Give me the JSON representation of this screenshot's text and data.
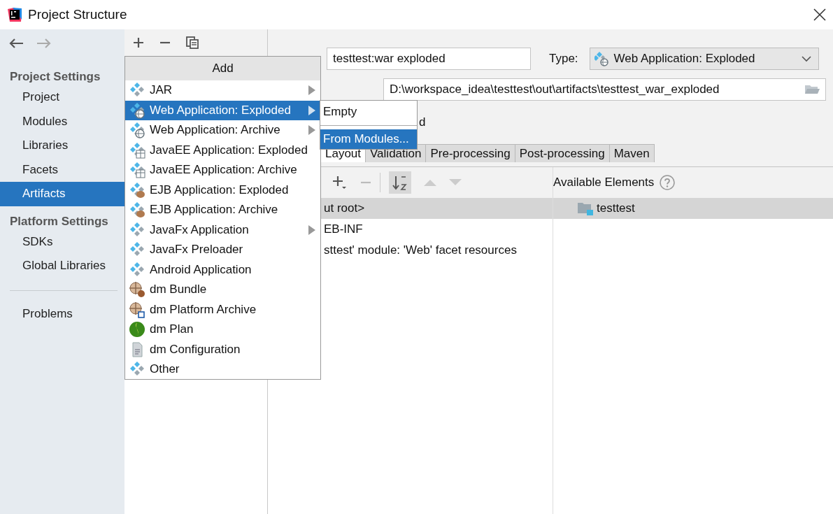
{
  "window": {
    "title": "Project Structure"
  },
  "sidebar": {
    "sections": [
      {
        "title": "Project Settings",
        "items": [
          {
            "label": "Project",
            "selected": false
          },
          {
            "label": "Modules",
            "selected": false
          },
          {
            "label": "Libraries",
            "selected": false
          },
          {
            "label": "Facets",
            "selected": false
          },
          {
            "label": "Artifacts",
            "selected": true
          }
        ]
      },
      {
        "title": "Platform Settings",
        "items": [
          {
            "label": "SDKs",
            "selected": false
          },
          {
            "label": "Global Libraries",
            "selected": false
          }
        ]
      }
    ],
    "extra_items": [
      {
        "label": "Problems",
        "selected": false
      }
    ]
  },
  "artifact": {
    "name": "testtest:war exploded",
    "type_label": "Type:",
    "type_value": "Web Application: Exploded",
    "output_path": "D:\\workspace_idea\\testtest\\out\\artifacts\\testtest_war_exploded",
    "build_option": "d"
  },
  "tabs": [
    {
      "label": "Layout",
      "selected": true
    },
    {
      "label": "Validation",
      "selected": false
    },
    {
      "label": "Pre-processing",
      "selected": false
    },
    {
      "label": "Post-processing",
      "selected": false
    },
    {
      "label": "Maven",
      "selected": false
    }
  ],
  "layout": {
    "tree_rows": [
      {
        "label": "ut root>",
        "selected": true
      },
      {
        "label": "EB-INF",
        "selected": false
      },
      {
        "label": "sttest' module: 'Web' facet resources",
        "selected": false
      }
    ],
    "available_title": "Available Elements",
    "available_items": [
      {
        "label": "testtest",
        "selected": true
      }
    ]
  },
  "add_menu": {
    "title": "Add",
    "items": [
      {
        "label": "JAR",
        "kind": "artifact",
        "submenu": true,
        "selected": false
      },
      {
        "label": "Web Application: Exploded",
        "kind": "web",
        "submenu": true,
        "selected": true
      },
      {
        "label": "Web Application: Archive",
        "kind": "web",
        "submenu": true,
        "selected": false
      },
      {
        "label": "JavaEE Application: Exploded",
        "kind": "javaee",
        "submenu": false,
        "selected": false
      },
      {
        "label": "JavaEE Application: Archive",
        "kind": "javaee",
        "submenu": false,
        "selected": false
      },
      {
        "label": "EJB Application: Exploded",
        "kind": "ejb",
        "submenu": false,
        "selected": false
      },
      {
        "label": "EJB Application: Archive",
        "kind": "ejb",
        "submenu": false,
        "selected": false
      },
      {
        "label": "JavaFx Application",
        "kind": "artifact",
        "submenu": true,
        "selected": false
      },
      {
        "label": "JavaFx Preloader",
        "kind": "artifact",
        "submenu": false,
        "selected": false
      },
      {
        "label": "Android Application",
        "kind": "artifact",
        "submenu": false,
        "selected": false
      },
      {
        "label": "dm Bundle",
        "kind": "bundle",
        "submenu": false,
        "selected": false
      },
      {
        "label": "dm Platform Archive",
        "kind": "platform",
        "submenu": false,
        "selected": false
      },
      {
        "label": "dm Plan",
        "kind": "plan",
        "submenu": false,
        "selected": false
      },
      {
        "label": "dm Configuration",
        "kind": "config",
        "submenu": false,
        "selected": false
      },
      {
        "label": "Other",
        "kind": "artifact",
        "submenu": false,
        "selected": false
      }
    ]
  },
  "submenu": {
    "items": [
      {
        "label": "Empty",
        "selected": false
      },
      {
        "label": "From Modules...",
        "selected": true
      }
    ]
  }
}
